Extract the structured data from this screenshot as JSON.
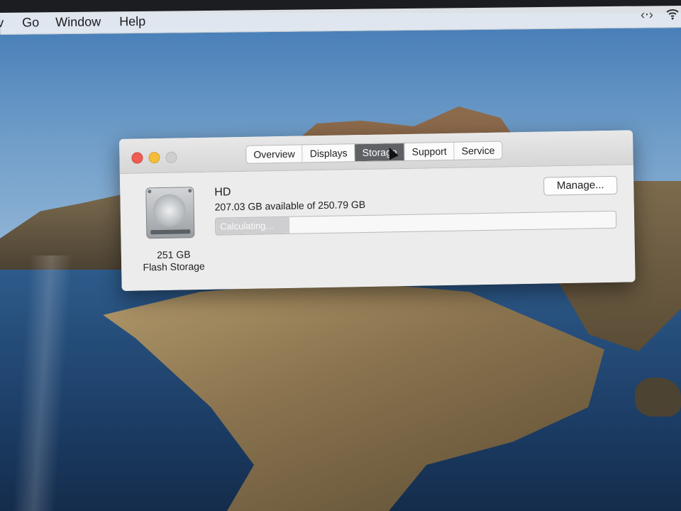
{
  "menubar": {
    "items": [
      "v",
      "Go",
      "Window",
      "Help"
    ],
    "status_icons": [
      "code-icon",
      "wifi-icon"
    ]
  },
  "window": {
    "tabs": [
      {
        "label": "Overview",
        "active": false
      },
      {
        "label": "Displays",
        "active": false
      },
      {
        "label": "Storage",
        "active": true
      },
      {
        "label": "Support",
        "active": false
      },
      {
        "label": "Service",
        "active": false
      }
    ],
    "disk": {
      "name": "HD",
      "availability": "207.03 GB available of 250.79 GB",
      "capacity": "251 GB",
      "type": "Flash Storage",
      "icon": "hard-drive-icon"
    },
    "manage_label": "Manage...",
    "progress_label": "Calculating..."
  },
  "colors": {
    "active_tab": "#5f6165",
    "close": "#ee5d54",
    "minimize": "#f4bd3a"
  }
}
